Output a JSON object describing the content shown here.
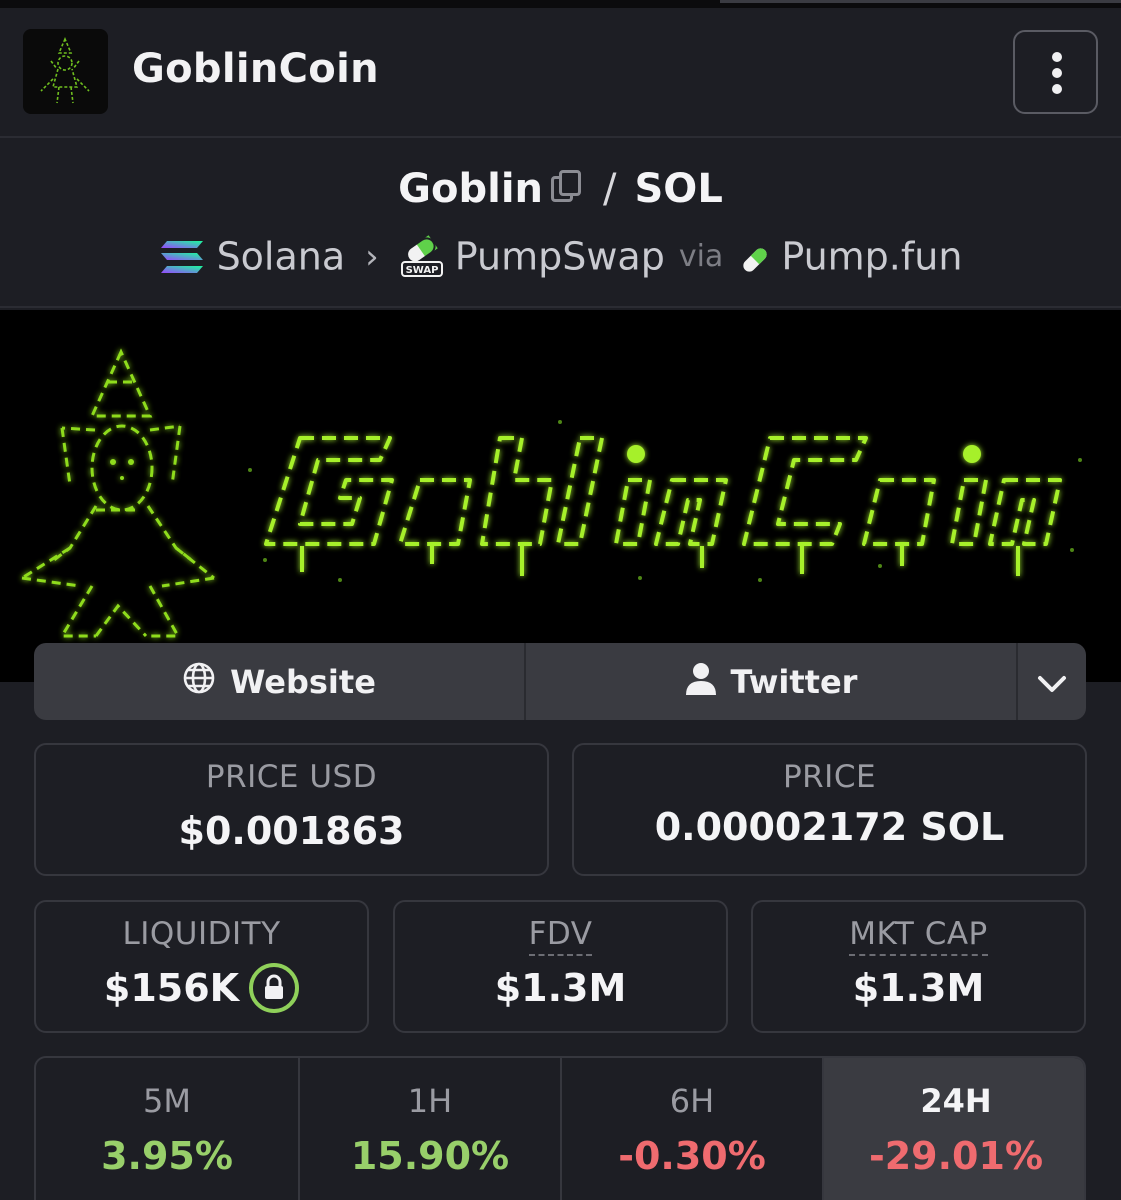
{
  "header": {
    "title": "GoblinCoin",
    "logo_icon": "goblin-logo-icon",
    "menu_icon": "kebab-menu-icon"
  },
  "pair": {
    "base": "Goblin",
    "separator": "/",
    "quote": "SOL",
    "chain": "Solana",
    "dex": "PumpSwap",
    "via_label": "via",
    "launchpad": "Pump.fun",
    "dex_badge": "SWAP"
  },
  "banner": {
    "text": "GoblinCoin",
    "accent": "#a6f02a"
  },
  "links": {
    "website_label": "Website",
    "twitter_label": "Twitter"
  },
  "stats": {
    "price_usd": {
      "label": "PRICE USD",
      "value": "$0.001863"
    },
    "price": {
      "label": "PRICE",
      "value": "0.00002172 SOL"
    },
    "liquidity": {
      "label": "LIQUIDITY",
      "value": "$156K"
    },
    "fdv": {
      "label": "FDV",
      "value": "$1.3M"
    },
    "mkt_cap": {
      "label": "MKT CAP",
      "value": "$1.3M"
    }
  },
  "changes": [
    {
      "period": "5M",
      "value": "3.95%",
      "trend": "up"
    },
    {
      "period": "1H",
      "value": "15.90%",
      "trend": "up"
    },
    {
      "period": "6H",
      "value": "-0.30%",
      "trend": "down"
    },
    {
      "period": "24H",
      "value": "-29.01%",
      "trend": "down",
      "selected": true
    }
  ],
  "colors": {
    "positive": "#98cf6a",
    "negative": "#ef6b6f",
    "background": "#1d1e24"
  }
}
